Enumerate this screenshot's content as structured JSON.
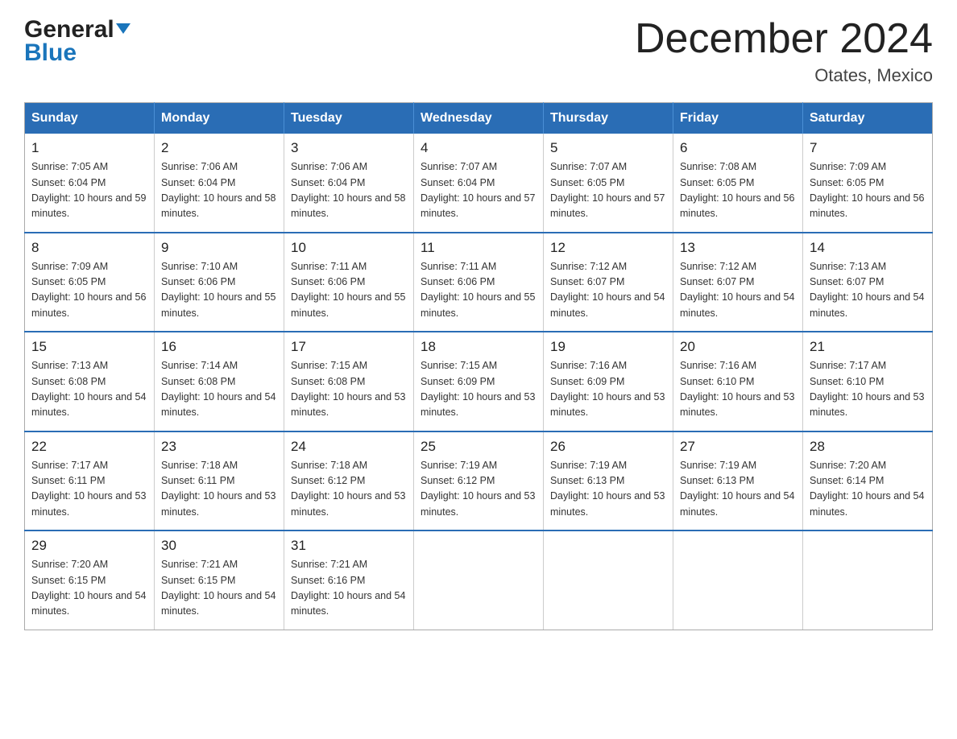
{
  "header": {
    "logo_general": "General",
    "logo_blue": "Blue",
    "month_title": "December 2024",
    "location": "Otates, Mexico"
  },
  "calendar": {
    "days_of_week": [
      "Sunday",
      "Monday",
      "Tuesday",
      "Wednesday",
      "Thursday",
      "Friday",
      "Saturday"
    ],
    "weeks": [
      [
        {
          "day": 1,
          "sunrise": "7:05 AM",
          "sunset": "6:04 PM",
          "daylight": "10 hours and 59 minutes."
        },
        {
          "day": 2,
          "sunrise": "7:06 AM",
          "sunset": "6:04 PM",
          "daylight": "10 hours and 58 minutes."
        },
        {
          "day": 3,
          "sunrise": "7:06 AM",
          "sunset": "6:04 PM",
          "daylight": "10 hours and 58 minutes."
        },
        {
          "day": 4,
          "sunrise": "7:07 AM",
          "sunset": "6:04 PM",
          "daylight": "10 hours and 57 minutes."
        },
        {
          "day": 5,
          "sunrise": "7:07 AM",
          "sunset": "6:05 PM",
          "daylight": "10 hours and 57 minutes."
        },
        {
          "day": 6,
          "sunrise": "7:08 AM",
          "sunset": "6:05 PM",
          "daylight": "10 hours and 56 minutes."
        },
        {
          "day": 7,
          "sunrise": "7:09 AM",
          "sunset": "6:05 PM",
          "daylight": "10 hours and 56 minutes."
        }
      ],
      [
        {
          "day": 8,
          "sunrise": "7:09 AM",
          "sunset": "6:05 PM",
          "daylight": "10 hours and 56 minutes."
        },
        {
          "day": 9,
          "sunrise": "7:10 AM",
          "sunset": "6:06 PM",
          "daylight": "10 hours and 55 minutes."
        },
        {
          "day": 10,
          "sunrise": "7:11 AM",
          "sunset": "6:06 PM",
          "daylight": "10 hours and 55 minutes."
        },
        {
          "day": 11,
          "sunrise": "7:11 AM",
          "sunset": "6:06 PM",
          "daylight": "10 hours and 55 minutes."
        },
        {
          "day": 12,
          "sunrise": "7:12 AM",
          "sunset": "6:07 PM",
          "daylight": "10 hours and 54 minutes."
        },
        {
          "day": 13,
          "sunrise": "7:12 AM",
          "sunset": "6:07 PM",
          "daylight": "10 hours and 54 minutes."
        },
        {
          "day": 14,
          "sunrise": "7:13 AM",
          "sunset": "6:07 PM",
          "daylight": "10 hours and 54 minutes."
        }
      ],
      [
        {
          "day": 15,
          "sunrise": "7:13 AM",
          "sunset": "6:08 PM",
          "daylight": "10 hours and 54 minutes."
        },
        {
          "day": 16,
          "sunrise": "7:14 AM",
          "sunset": "6:08 PM",
          "daylight": "10 hours and 54 minutes."
        },
        {
          "day": 17,
          "sunrise": "7:15 AM",
          "sunset": "6:08 PM",
          "daylight": "10 hours and 53 minutes."
        },
        {
          "day": 18,
          "sunrise": "7:15 AM",
          "sunset": "6:09 PM",
          "daylight": "10 hours and 53 minutes."
        },
        {
          "day": 19,
          "sunrise": "7:16 AM",
          "sunset": "6:09 PM",
          "daylight": "10 hours and 53 minutes."
        },
        {
          "day": 20,
          "sunrise": "7:16 AM",
          "sunset": "6:10 PM",
          "daylight": "10 hours and 53 minutes."
        },
        {
          "day": 21,
          "sunrise": "7:17 AM",
          "sunset": "6:10 PM",
          "daylight": "10 hours and 53 minutes."
        }
      ],
      [
        {
          "day": 22,
          "sunrise": "7:17 AM",
          "sunset": "6:11 PM",
          "daylight": "10 hours and 53 minutes."
        },
        {
          "day": 23,
          "sunrise": "7:18 AM",
          "sunset": "6:11 PM",
          "daylight": "10 hours and 53 minutes."
        },
        {
          "day": 24,
          "sunrise": "7:18 AM",
          "sunset": "6:12 PM",
          "daylight": "10 hours and 53 minutes."
        },
        {
          "day": 25,
          "sunrise": "7:19 AM",
          "sunset": "6:12 PM",
          "daylight": "10 hours and 53 minutes."
        },
        {
          "day": 26,
          "sunrise": "7:19 AM",
          "sunset": "6:13 PM",
          "daylight": "10 hours and 53 minutes."
        },
        {
          "day": 27,
          "sunrise": "7:19 AM",
          "sunset": "6:13 PM",
          "daylight": "10 hours and 54 minutes."
        },
        {
          "day": 28,
          "sunrise": "7:20 AM",
          "sunset": "6:14 PM",
          "daylight": "10 hours and 54 minutes."
        }
      ],
      [
        {
          "day": 29,
          "sunrise": "7:20 AM",
          "sunset": "6:15 PM",
          "daylight": "10 hours and 54 minutes."
        },
        {
          "day": 30,
          "sunrise": "7:21 AM",
          "sunset": "6:15 PM",
          "daylight": "10 hours and 54 minutes."
        },
        {
          "day": 31,
          "sunrise": "7:21 AM",
          "sunset": "6:16 PM",
          "daylight": "10 hours and 54 minutes."
        },
        null,
        null,
        null,
        null
      ]
    ]
  }
}
